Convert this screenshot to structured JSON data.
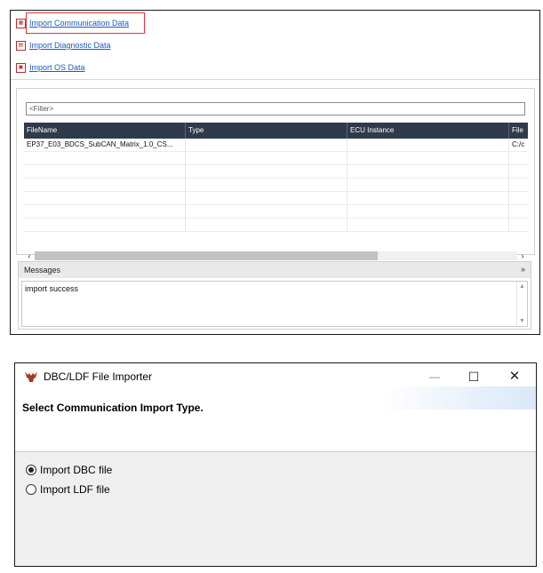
{
  "import_links": [
    {
      "label": "Import Communication Data",
      "icon": "communication-data-icon"
    },
    {
      "label": "Import Diagnostic Data",
      "icon": "diagnostic-data-icon"
    },
    {
      "label": "Import OS Data",
      "icon": "os-data-icon"
    }
  ],
  "filter": {
    "placeholder": "<Filter>"
  },
  "table": {
    "columns": [
      "FileName",
      "Type",
      "ECU Instance",
      "File"
    ],
    "rows": [
      [
        "EP37_E03_BDCS_SubCAN_Matrix_1.0_CS...",
        "",
        "",
        "C:/c"
      ]
    ]
  },
  "messages": {
    "title": "Messages",
    "text": "import success"
  },
  "dialog": {
    "title": "DBC/LDF File Importer",
    "heading": "Select Communication Import Type.",
    "options": [
      {
        "label": "Import DBC file",
        "checked": true
      },
      {
        "label": "Import LDF file",
        "checked": false
      }
    ]
  },
  "colors": {
    "link": "#1e5bb8",
    "highlight": "#d63b3b",
    "table_header": "#2f3a4a"
  }
}
